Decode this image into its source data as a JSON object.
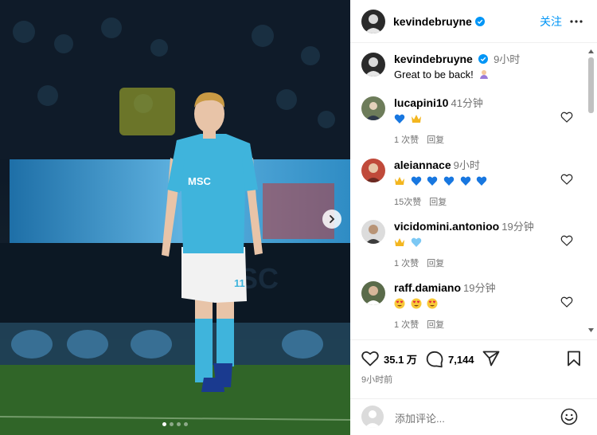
{
  "post": {
    "username": "kevindebruyne",
    "follow_label": "关注",
    "caption_time": "9小时",
    "caption_text": "Great to be back!",
    "caption_emoji": "hands-icon"
  },
  "photo": {
    "sponsor_text": "MSC",
    "shirt_number": "11",
    "carousel_pages": 4,
    "carousel_active": 1
  },
  "comments": [
    {
      "username": "lucapini10",
      "time": "41分钟",
      "emojis": [
        "blue-heart",
        "crown"
      ],
      "likes": "1 次赞",
      "reply": "回复"
    },
    {
      "username": "aleiannace",
      "time": "9小时",
      "emojis": [
        "crown",
        "blue-heart",
        "blue-heart",
        "blue-heart",
        "blue-heart",
        "blue-heart"
      ],
      "likes": "15次赞",
      "reply": "回复"
    },
    {
      "username": "vicidomini.antonioo",
      "time": "19分钟",
      "emojis": [
        "crown",
        "light-blue-heart"
      ],
      "likes": "1 次赞",
      "reply": "回复"
    },
    {
      "username": "raff.damiano",
      "time": "19分钟",
      "emojis": [
        "heart-eyes",
        "heart-eyes",
        "heart-eyes"
      ],
      "likes": "1 次赞",
      "reply": "回复"
    }
  ],
  "actions": {
    "likes": "35.1 万",
    "comments": "7,144",
    "posted": "9小时前"
  },
  "add_comment": {
    "placeholder": "添加评论..."
  },
  "colors": {
    "accent": "#0095f6",
    "meta": "#737373",
    "jersey": "#3fb4dc",
    "verified": "#0095f6"
  }
}
